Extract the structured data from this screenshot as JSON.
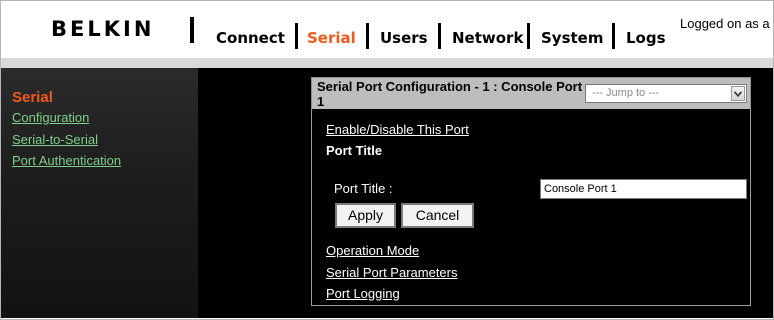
{
  "header": {
    "logo": "BELKIN",
    "nav": [
      {
        "label": "Connect",
        "active": false
      },
      {
        "label": "Serial",
        "active": true
      },
      {
        "label": "Users",
        "active": false
      },
      {
        "label": "Network",
        "active": false
      },
      {
        "label": "System",
        "active": false
      },
      {
        "label": "Logs",
        "active": false
      }
    ],
    "logged_on": "Logged on as a"
  },
  "sidebar": {
    "title": "Serial",
    "links": [
      "Configuration",
      "Serial-to-Serial",
      "Port Authentication"
    ]
  },
  "panel": {
    "title": "Serial Port Configuration - 1 : Console Port 1",
    "jump_to": "--- Jump to ---",
    "enable_link": "Enable/Disable This Port",
    "section_title": "Port Title",
    "port_title_label": "Port Title :",
    "port_title_value": "Console Port 1",
    "apply_label": "Apply",
    "cancel_label": "Cancel",
    "links": [
      "Operation Mode",
      "Serial Port Parameters",
      "Port Logging"
    ]
  },
  "colors": {
    "accent": "#f05a1c",
    "sidebar_link": "#7fcf8a"
  }
}
